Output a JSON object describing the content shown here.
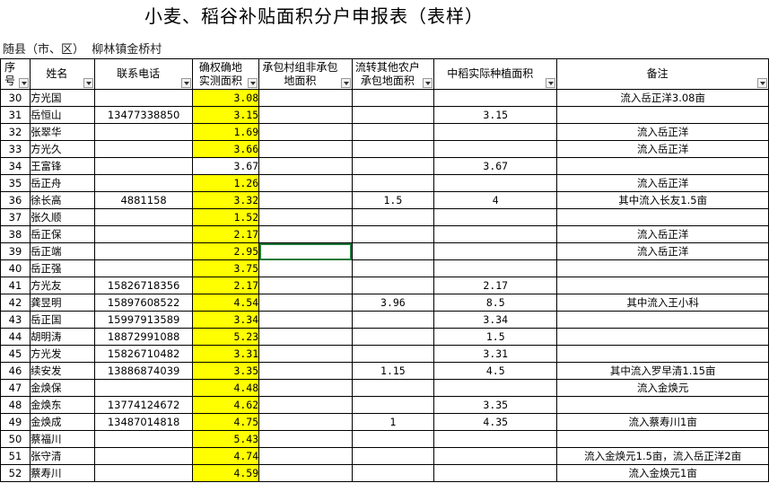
{
  "sheet": {
    "title": "小麦、稻谷补贴面积分户申报表（表样）",
    "region": "随县（市、区）  柳林镇金桥村"
  },
  "columns": {
    "seq": "序号",
    "name": "姓名",
    "phone": "联系电话",
    "confirmed_area": "确权确地实测面积",
    "contract_area": "承包村组非承包地面积",
    "transfer_area": "流转其他农户承包地面积",
    "actual_area": "中稻实际种植面积",
    "remarks": "备注"
  },
  "rows": [
    {
      "seq": "30",
      "name": "方光国",
      "phone": "",
      "area": "3.08",
      "contract": "",
      "transfer": "",
      "actual": "",
      "remark": "流入岳正洋3.08亩"
    },
    {
      "seq": "31",
      "name": "岳恒山",
      "phone": "13477338850",
      "area": "3.15",
      "contract": "",
      "transfer": "",
      "actual": "3.15",
      "remark": ""
    },
    {
      "seq": "32",
      "name": "张翠华",
      "phone": "",
      "area": "1.69",
      "contract": "",
      "transfer": "",
      "actual": "",
      "remark": "流入岳正洋"
    },
    {
      "seq": "33",
      "name": "方光久",
      "phone": "",
      "area": "3.66",
      "contract": "",
      "transfer": "",
      "actual": "",
      "remark": "流入岳正洋"
    },
    {
      "seq": "34",
      "name": "王富锋",
      "phone": "",
      "area": "3.67",
      "contract": "",
      "transfer": "",
      "actual": "3.67",
      "remark": "",
      "plain": true
    },
    {
      "seq": "35",
      "name": "岳正舟",
      "phone": "",
      "area": "1.26",
      "contract": "",
      "transfer": "",
      "actual": "",
      "remark": "流入岳正洋"
    },
    {
      "seq": "36",
      "name": "徐长高",
      "phone": "4881158",
      "area": "3.32",
      "contract": "",
      "transfer": "1.5",
      "actual": "4",
      "remark": "其中流入长友1.5亩"
    },
    {
      "seq": "37",
      "name": "张久顺",
      "phone": "",
      "area": "1.52",
      "contract": "",
      "transfer": "",
      "actual": "",
      "remark": ""
    },
    {
      "seq": "38",
      "name": "岳正保",
      "phone": "",
      "area": "2.17",
      "contract": "",
      "transfer": "",
      "actual": "",
      "remark": "流入岳正洋"
    },
    {
      "seq": "39",
      "name": "岳正端",
      "phone": "",
      "area": "2.95",
      "contract": "",
      "transfer": "",
      "actual": "",
      "remark": "流入岳正洋",
      "selected": true
    },
    {
      "seq": "40",
      "name": "岳正强",
      "phone": "",
      "area": "3.75",
      "contract": "",
      "transfer": "",
      "actual": "",
      "remark": ""
    },
    {
      "seq": "41",
      "name": "方光友",
      "phone": "15826718356",
      "area": "2.17",
      "contract": "",
      "transfer": "",
      "actual": "2.17",
      "remark": ""
    },
    {
      "seq": "42",
      "name": "龚昱明",
      "phone": "15897608522",
      "area": "4.54",
      "contract": "",
      "transfer": "3.96",
      "actual": "8.5",
      "remark": "其中流入王小科"
    },
    {
      "seq": "43",
      "name": "岳正国",
      "phone": "15997913589",
      "area": "3.34",
      "contract": "",
      "transfer": "",
      "actual": "3.34",
      "remark": ""
    },
    {
      "seq": "44",
      "name": "胡明涛",
      "phone": "18872991088",
      "area": "5.23",
      "contract": "",
      "transfer": "",
      "actual": "1.5",
      "remark": ""
    },
    {
      "seq": "45",
      "name": "方光发",
      "phone": "15826710482",
      "area": "3.31",
      "contract": "",
      "transfer": "",
      "actual": "3.31",
      "remark": ""
    },
    {
      "seq": "46",
      "name": "续安发",
      "phone": "13886874039",
      "area": "3.35",
      "contract": "",
      "transfer": "1.15",
      "actual": "4.5",
      "remark": "其中流入罗早清1.15亩"
    },
    {
      "seq": "47",
      "name": "金焕保",
      "phone": "",
      "area": "4.48",
      "contract": "",
      "transfer": "",
      "actual": "",
      "remark": "流入金焕元"
    },
    {
      "seq": "48",
      "name": "金焕东",
      "phone": "13774124672",
      "area": "4.62",
      "contract": "",
      "transfer": "",
      "actual": "3.35",
      "remark": ""
    },
    {
      "seq": "49",
      "name": "金焕成",
      "phone": "13487014818",
      "area": "4.75",
      "contract": "",
      "transfer": "1",
      "actual": "4.35",
      "remark": "流入蔡寿川1亩"
    },
    {
      "seq": "50",
      "name": "蔡福川",
      "phone": "",
      "area": "5.43",
      "contract": "",
      "transfer": "",
      "actual": "",
      "remark": ""
    },
    {
      "seq": "51",
      "name": "张守清",
      "phone": "",
      "area": "4.74",
      "contract": "",
      "transfer": "",
      "actual": "",
      "remark": "流入金焕元1.5亩，流入岳正洋2亩"
    },
    {
      "seq": "52",
      "name": "蔡寿川",
      "phone": "",
      "area": "4.59",
      "contract": "",
      "transfer": "",
      "actual": "",
      "remark": "流入金焕元1亩"
    }
  ],
  "colors": {
    "highlight": "#ffff00",
    "selection": "#1e7a3c"
  }
}
